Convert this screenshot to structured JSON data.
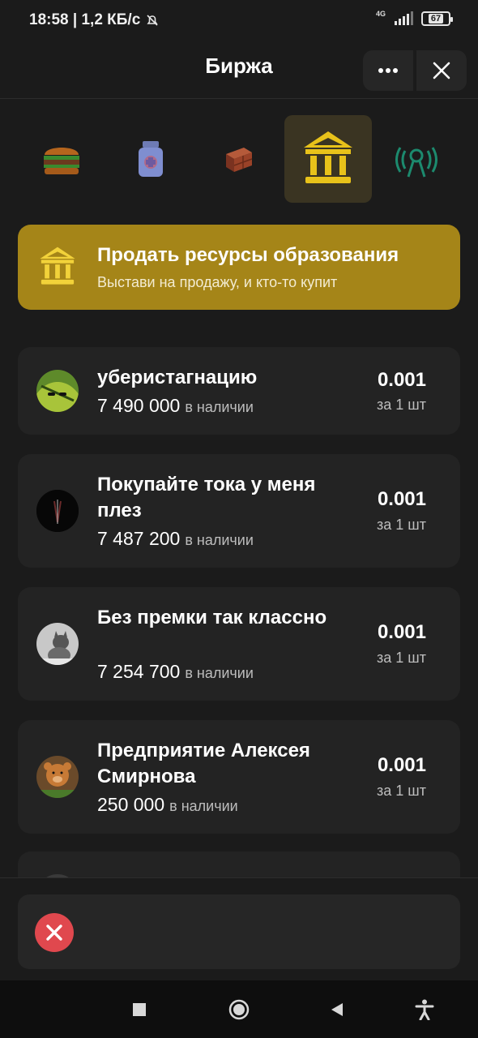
{
  "status_bar": {
    "time_speed": "18:58 | 1,2 КБ/с",
    "network": "4G",
    "battery": "67"
  },
  "header": {
    "title": "Биржа",
    "more_icon": "more-dots-icon",
    "close_icon": "close-icon"
  },
  "categories": [
    {
      "name": "food",
      "icon": "burger-icon",
      "active": false
    },
    {
      "name": "medicine",
      "icon": "medicine-jar-icon",
      "active": false
    },
    {
      "name": "materials",
      "icon": "brick-icon",
      "active": false
    },
    {
      "name": "education",
      "icon": "institution-icon",
      "active": true
    },
    {
      "name": "communication",
      "icon": "broadcast-tower-icon",
      "active": false
    }
  ],
  "banner": {
    "title": "Продать ресурсы образования",
    "subtitle": "Выстави на продажу, и кто-то купит",
    "color": "#a58518"
  },
  "listings": [
    {
      "name": "уберистагнацию",
      "quantity": "7 490 000",
      "quantity_suffix": "в наличии",
      "price": "0.001",
      "unit": "за 1 шт",
      "avatar": "avatar-green-leaf"
    },
    {
      "name": "Покупайте тока у меня плез",
      "quantity": "7 487 200",
      "quantity_suffix": "в наличии",
      "price": "0.001",
      "unit": "за 1 шт",
      "avatar": "avatar-dark"
    },
    {
      "name": "Без премки так классно",
      "quantity": "7 254 700",
      "quantity_suffix": "в наличии",
      "price": "0.001",
      "unit": "за 1 шт",
      "avatar": "avatar-cat"
    },
    {
      "name": "Предприятие Алексея Смирнова",
      "quantity": "250 000",
      "quantity_suffix": "в наличии",
      "price": "0.001",
      "unit": "за 1 шт",
      "avatar": "avatar-bear"
    }
  ],
  "error": {
    "icon": "error-close-icon",
    "color": "#e0484e"
  },
  "nav": {
    "recent_icon": "square-icon",
    "home_icon": "circle-home-icon",
    "back_icon": "back-triangle-icon",
    "accessibility_icon": "accessibility-icon"
  }
}
